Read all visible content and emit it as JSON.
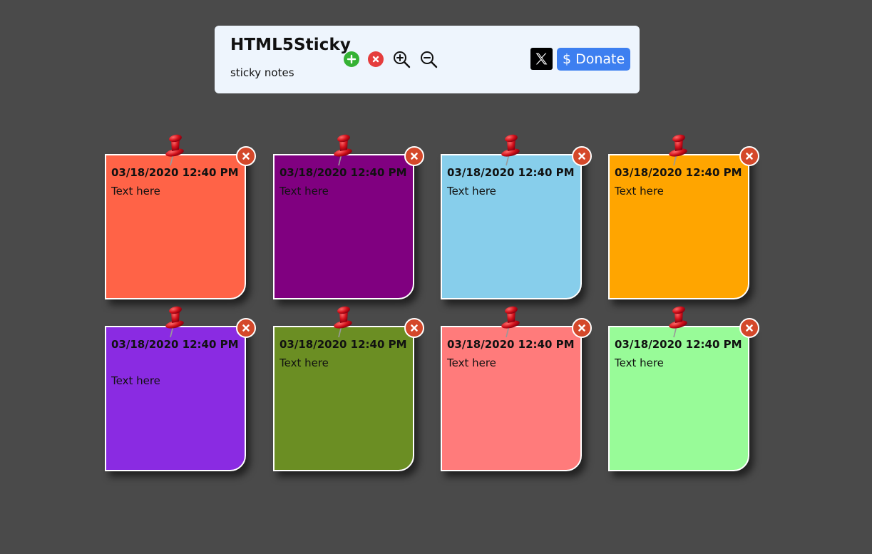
{
  "app": {
    "title": "HTML5Sticky",
    "subtitle": "sticky notes"
  },
  "toolbar": {
    "icons": [
      "add-note-icon",
      "remove-notes-icon",
      "zoom-in-icon",
      "zoom-out-icon"
    ],
    "x_icon": "x-logo-icon",
    "donate_symbol": "$",
    "donate_label": "Donate",
    "donate_color": "#3d7ff0"
  },
  "notes": [
    {
      "date": "03/18/2020 12:40 PM",
      "text": "Text here",
      "color": "#ff6347"
    },
    {
      "date": "03/18/2020 12:40 PM",
      "text": "Text here",
      "color": "#800080"
    },
    {
      "date": "03/18/2020 12:40 PM",
      "text": "Text here",
      "color": "#87ceeb"
    },
    {
      "date": "03/18/2020 12:40 PM",
      "text": "Text here",
      "color": "#ffa500"
    },
    {
      "date": "03/18/2020 12:40 PM",
      "text": "Text here",
      "color": "#8a2be2"
    },
    {
      "date": "03/18/2020 12:40 PM",
      "text": "Text here",
      "color": "#6b8e23"
    },
    {
      "date": "03/18/2020 12:40 PM",
      "text": "Text here",
      "color": "#ff7b7b"
    },
    {
      "date": "03/18/2020 12:40 PM",
      "text": "Text here",
      "color": "#98fb98"
    }
  ]
}
